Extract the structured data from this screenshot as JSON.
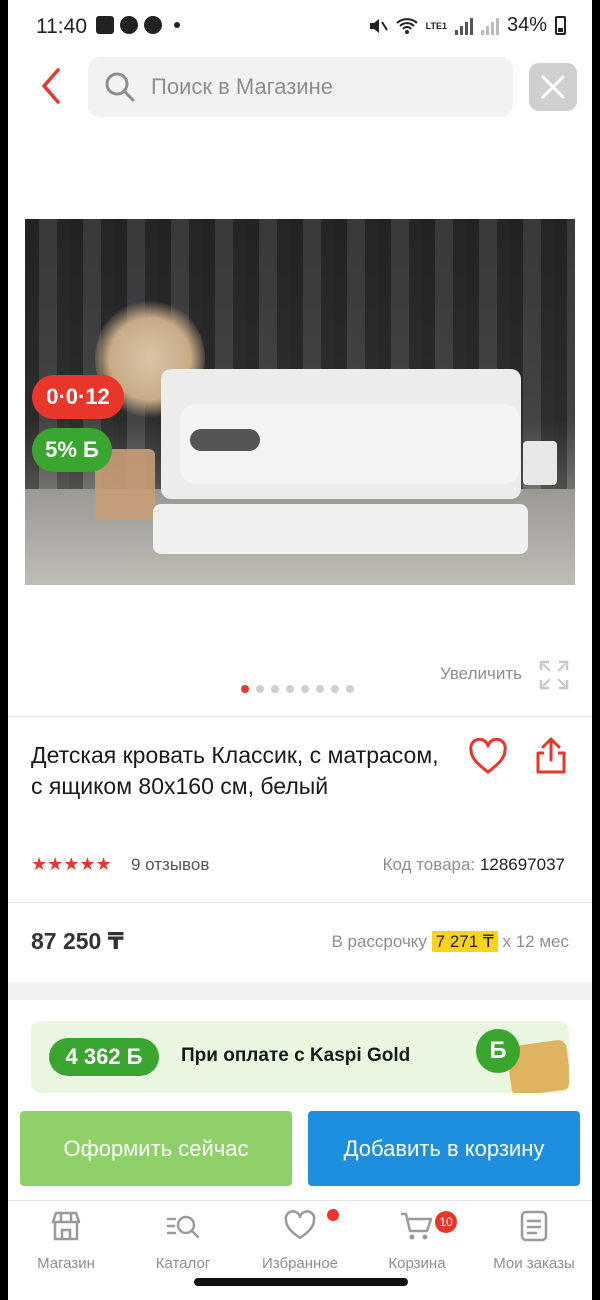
{
  "status_bar": {
    "time": "11:40",
    "network": "LTE1",
    "battery": "34%"
  },
  "search": {
    "placeholder": "Поиск в Магазине"
  },
  "gallery": {
    "badge_installment": "0·0·12",
    "badge_bonus": "5% Б",
    "zoom_label": "Увеличить",
    "slides_total": 8,
    "active_slide": 1
  },
  "product": {
    "title": "Детская кровать Классик, с матрасом, с ящиком 80x160 см, белый",
    "rating": 5,
    "stars": "★★★★★",
    "reviews": "9 отзывов",
    "code_label": "Код товара:",
    "code": "128697037",
    "price": "87 250 ₸",
    "installment_prefix": "В рассрочку",
    "installment_amount": "7 271 ₸",
    "installment_suffix": "x 12 мес"
  },
  "kaspi_gold": {
    "bonus": "4 362 Б",
    "text": "При оплате с Kaspi Gold",
    "coin": "Б"
  },
  "actions": {
    "buy_now": "Оформить сейчас",
    "add_to_cart": "Добавить в корзину"
  },
  "nav": {
    "shop": "Магазин",
    "catalog": "Каталог",
    "favorites": "Избранное",
    "cart": "Корзина",
    "cart_count": "10",
    "orders": "Мои заказы"
  },
  "colors": {
    "accent_red": "#e8372a",
    "kaspi_green": "#3aa52f",
    "buy_now_green": "#8fd168",
    "cart_blue": "#1d8fde",
    "installment_yellow": "#ffd21f"
  }
}
